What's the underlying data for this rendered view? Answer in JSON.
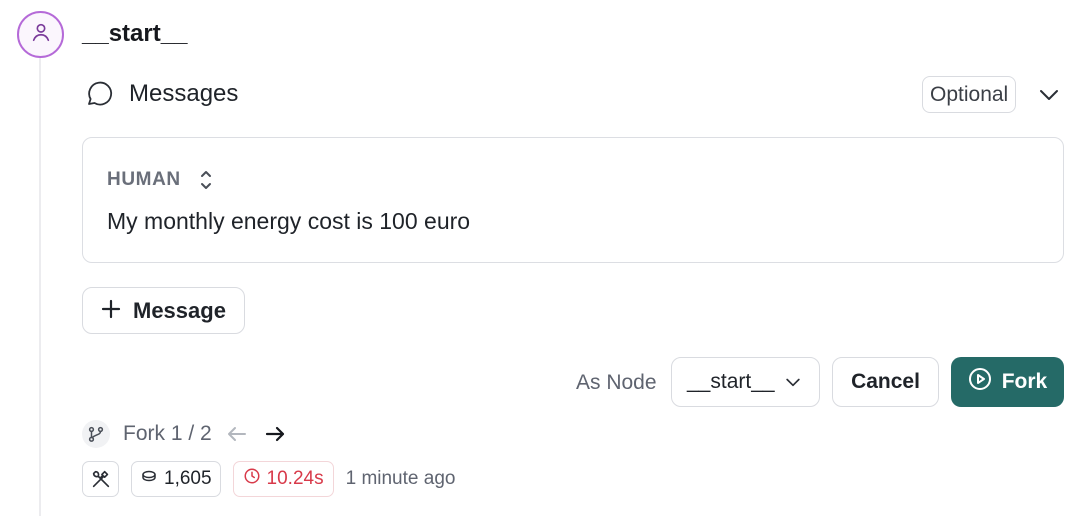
{
  "node": {
    "title": "__start__",
    "icon": "user-icon"
  },
  "messages_section": {
    "label": "Messages",
    "icon": "chat-bubble-icon",
    "badge": "Optional",
    "collapse_icon": "chevron-down-icon"
  },
  "message": {
    "role": "HUMAN",
    "role_switch_icon": "chevron-up-down-icon",
    "content": "My monthly energy cost is 100 euro"
  },
  "add_message": {
    "label": "Message",
    "icon": "plus-icon"
  },
  "fork_controls": {
    "as_node_label": "As Node",
    "node_value": "__start__",
    "cancel_label": "Cancel",
    "fork_label": "Fork",
    "fork_icon": "play-circle-icon"
  },
  "fork_nav": {
    "label": "Fork 1 / 2",
    "branch_icon": "git-branch-icon",
    "prev_icon": "arrow-left-icon",
    "next_icon": "arrow-right-icon"
  },
  "meta": {
    "tools_icon": "tools-icon",
    "tokens": "1,605",
    "tokens_icon": "coins-icon",
    "latency": "10.24s",
    "latency_icon": "clock-icon",
    "time_ago": "1 minute ago"
  },
  "colors": {
    "accent": "#256a67",
    "avatar_border": "#b56ad8",
    "latency": "#d83a4a"
  }
}
